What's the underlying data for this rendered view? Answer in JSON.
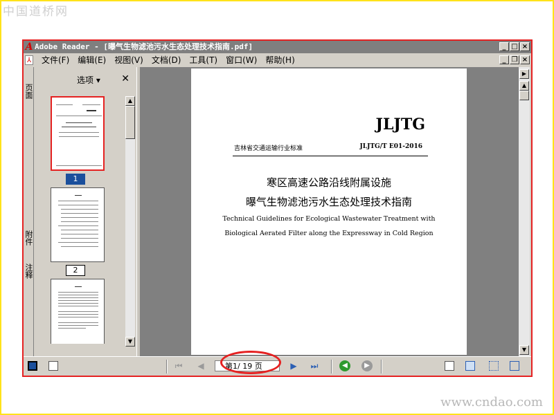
{
  "watermark": {
    "top": "中国道桥网",
    "bottom": "www.cndao.com"
  },
  "window": {
    "title": "Adobe Reader - [曝气生物滤池污水生态处理技术指南.pdf]",
    "app_icon": "adobe-reader-logo-icon",
    "controls": {
      "minimize": "_",
      "maximize": "□",
      "close": "×",
      "restore": "❐"
    }
  },
  "menubar": {
    "items": [
      "文件(F)",
      "编辑(E)",
      "视图(V)",
      "文档(D)",
      "工具(T)",
      "窗口(W)",
      "帮助(H)"
    ]
  },
  "side_tabs": {
    "pages": "页面",
    "attachments": "附件",
    "comments": "注释"
  },
  "nav_panel": {
    "options_label": "选项",
    "options_arrow": "▾",
    "close_label": "✕",
    "thumbnails": [
      {
        "label": "1",
        "selected": true
      },
      {
        "label": "2",
        "selected": false
      }
    ]
  },
  "document": {
    "brand": "JLJTG",
    "issuer": "吉林省交通运输行业标准",
    "code": "JLJTG/T E01-2016",
    "title_line1": "寒区高速公路沿线附属设施",
    "title_line2": "曝气生物滤池污水生态处理技术指南",
    "english_line1": "Technical Guidelines for Ecological Wastewater Treatment with",
    "english_line2": "Biological Aerated Filter along the Expressway in Cold Region"
  },
  "statusbar": {
    "page_prefix": "第",
    "current_page": "1",
    "page_separator": "/",
    "total_pages": "19",
    "page_suffix": "页",
    "icons": [
      "first-page-icon",
      "prev-page-icon",
      "next-page-icon",
      "last-page-icon",
      "go-back-icon",
      "go-forward-icon",
      "single-page-icon",
      "continuous-icon",
      "facing-icon",
      "continuous-facing-icon"
    ]
  },
  "colors": {
    "highlight": "#e52121",
    "selection": "#1b4f9c",
    "frame": "#ffe21a",
    "back_btn": "#2e9a2e",
    "fwd_btn": "#9a9a9a"
  }
}
